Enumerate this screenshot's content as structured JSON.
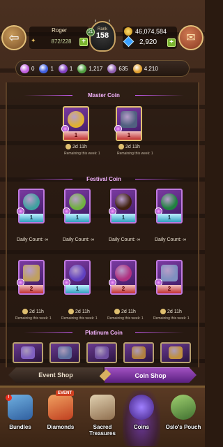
{
  "header": {
    "player_name": "Roger",
    "stamina": "872/228",
    "rank_label": "Rank",
    "rank_value": "158",
    "rank_small": "21",
    "gold": "46,074,584",
    "gems": "2,920"
  },
  "currencies": [
    {
      "icon": "pink-coin-icon",
      "value": "0",
      "color": "#c060e0"
    },
    {
      "icon": "blue-coin-icon",
      "value": "1",
      "color": "#4060e0"
    },
    {
      "icon": "purple-coin-icon",
      "value": "1",
      "color": "#8040c0"
    },
    {
      "icon": "green-coin-icon",
      "value": "1,217",
      "color": "#50a040"
    },
    {
      "icon": "violet-coin-icon",
      "value": "635",
      "color": "#9060b0"
    },
    {
      "icon": "gold-coin-icon",
      "value": "4,210",
      "color": "#e0a030"
    }
  ],
  "master_coin": {
    "title": "Master Coin",
    "items": [
      {
        "tag": "1",
        "tag_style": "red",
        "timer": "2d 11h",
        "remain": "Remaining this week: 1",
        "art": "#e0b030"
      },
      {
        "tag": "1",
        "tag_style": "red",
        "timer": "2d 11h",
        "remain": "Remaining this week: 1",
        "art": "#506080"
      }
    ]
  },
  "festival_coin": {
    "title": "Festival Coin",
    "row1": [
      {
        "tag": "1",
        "tag_style": "teal",
        "daily": "Daily Count: ∞",
        "art": "#40a0a0"
      },
      {
        "tag": "1",
        "tag_style": "teal",
        "daily": "Daily Count: ∞",
        "art": "#70b040"
      },
      {
        "tag": "1",
        "tag_style": "teal",
        "daily": "Daily Count: ∞",
        "art": "#402010"
      },
      {
        "tag": "1",
        "tag_style": "teal",
        "daily": "Daily Count: ∞",
        "art": "#208040"
      }
    ],
    "row2": [
      {
        "tag": "2",
        "tag_style": "red",
        "timer": "2d 11h",
        "remain": "Remaining this week: 1",
        "art": "#c0a060"
      },
      {
        "tag": "1",
        "tag_style": "teal",
        "timer": "2d 11h",
        "remain": "Remaining this week: 1",
        "art": "#6040c0"
      },
      {
        "tag": "2",
        "tag_style": "red",
        "timer": "2d 11h",
        "remain": "Remaining this week: 1",
        "art": "#b03080"
      },
      {
        "tag": "2",
        "tag_style": "red",
        "timer": "2d 11h",
        "remain": "Remaining this week: 1",
        "art": "#8090c0"
      }
    ]
  },
  "platinum_coin": {
    "title": "Platinum Coin",
    "arts": [
      "#8060c0",
      "#6070a0",
      "#7050a0",
      "#b08040",
      "#c09040"
    ]
  },
  "tabs": {
    "event_shop": "Event Shop",
    "coin_shop": "Coin Shop"
  },
  "bottom_nav": [
    {
      "label": "Bundles",
      "icon": "bundles-icon",
      "color": "#4080c0"
    },
    {
      "label": "Diamonds",
      "icon": "diamonds-icon",
      "color": "#e07030",
      "badge": "EVENT"
    },
    {
      "label": "Sacred Treasures",
      "icon": "sacred-treasures-icon",
      "color": "#c0a080"
    },
    {
      "label": "Coins",
      "icon": "coins-icon",
      "color": "#6040c0"
    },
    {
      "label": "Oslo's Pouch",
      "icon": "oslos-pouch-icon",
      "color": "#70a040"
    }
  ],
  "bundles_badge": "!"
}
